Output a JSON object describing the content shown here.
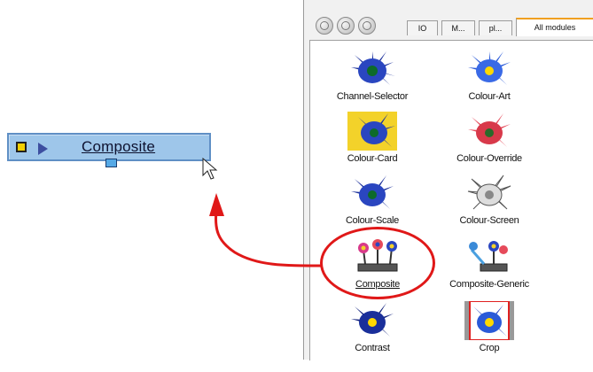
{
  "node": {
    "label": "Composite"
  },
  "toolbar": {
    "tabs": [
      "IO",
      "M...",
      "pl...",
      "All modules"
    ]
  },
  "modules": [
    {
      "label": "Channel-Selector",
      "icon": "daisy-icon"
    },
    {
      "label": "Colour-Art",
      "icon": "daisy-icon"
    },
    {
      "label": "Colour-Card",
      "icon": "daisy-card-icon"
    },
    {
      "label": "Colour-Override",
      "icon": "red-daisy-icon"
    },
    {
      "label": "Colour-Scale",
      "icon": "daisy-icon"
    },
    {
      "label": "Colour-Screen",
      "icon": "outline-daisy-icon"
    },
    {
      "label": "Composite",
      "icon": "composite-icon"
    },
    {
      "label": "Composite-Generic",
      "icon": "composite-generic-icon"
    },
    {
      "label": "Contrast",
      "icon": "daisy-icon"
    },
    {
      "label": "Crop",
      "icon": "crop-daisy-icon"
    }
  ],
  "colors": {
    "highlight": "#e01818",
    "node_fill": "#9ec6ea"
  }
}
